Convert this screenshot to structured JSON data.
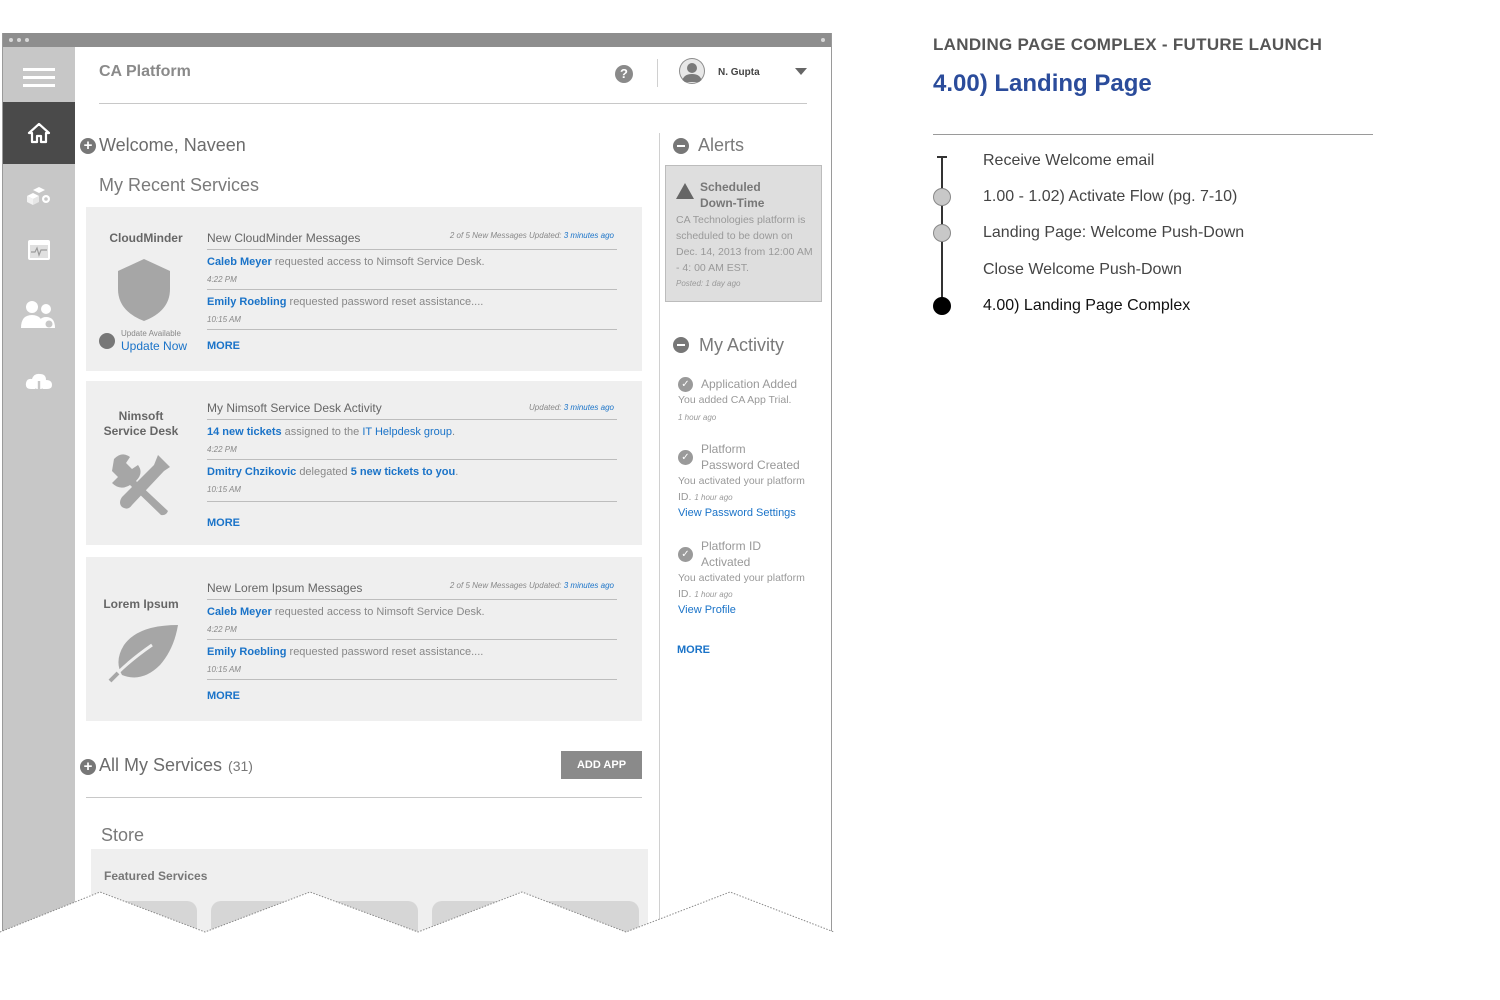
{
  "window": {
    "dots": 3
  },
  "header": {
    "app_title": "CA Platform",
    "help_glyph": "?",
    "user_name": "N. Gupta"
  },
  "sidebar": {
    "items": [
      {
        "icon": "home-icon"
      },
      {
        "icon": "apps-icon"
      },
      {
        "icon": "monitor-icon"
      },
      {
        "icon": "users-icon"
      },
      {
        "icon": "cloud-download-icon"
      }
    ]
  },
  "main": {
    "welcome": "Welcome, Naveen",
    "recent_heading": "My Recent Services",
    "cards": [
      {
        "name": "CloudMinder",
        "heading": "New CloudMinder Messages",
        "updated_prefix": "2 of 5 New Messages Updated:",
        "updated_link": "3 minutes ago",
        "msg1": {
          "who": "Caleb Meyer",
          "text": "requested access to Nimsoft Service Desk.",
          "time": "4:22 PM"
        },
        "msg2": {
          "who": "Emily Roebling",
          "text": "requested password reset assistance....",
          "time": "10:15 AM"
        },
        "more": "MORE",
        "update_available": "Update Available",
        "update_now": "Update Now"
      },
      {
        "name_line1": "Nimsoft",
        "name_line2": "Service Desk",
        "heading": "My Nimsoft Service Desk Activity",
        "updated_prefix": "Updated:",
        "updated_link": "3 minutes ago",
        "msg1": {
          "who": "14 new tickets",
          "text": "assigned to the",
          "link": "IT Helpdesk group",
          "end": ".",
          "time": "4:22 PM"
        },
        "msg2": {
          "who": "Dmitry Chzikovic",
          "text": "delegated",
          "link": "5 new tickets to you",
          "end": ".",
          "time": "10:15 AM"
        },
        "more": "MORE"
      },
      {
        "name": "Lorem Ipsum",
        "heading": "New Lorem Ipsum Messages",
        "updated_prefix": "2 of 5 New Messages Updated:",
        "updated_link": "3 minutes ago",
        "msg1": {
          "who": "Caleb Meyer",
          "text": "requested access to Nimsoft Service Desk.",
          "time": "4:22 PM"
        },
        "msg2": {
          "who": "Emily Roebling",
          "text": "requested password reset assistance....",
          "time": "10:15 AM"
        },
        "more": "MORE"
      }
    ],
    "all_services": "All My Services",
    "all_services_count": "(31)",
    "add_app": "ADD APP",
    "store": "Store",
    "featured": "Featured Services"
  },
  "right": {
    "alerts_heading": "Alerts",
    "alert": {
      "title_line1": "Scheduled",
      "title_line2": "Down-Time",
      "body": "CA Technologies platform is scheduled to be down on Dec. 14, 2013 from 12:00 AM - 4: 00 AM EST.",
      "posted": "Posted: 1 day ago"
    },
    "activity_heading": "My Activity",
    "activities": [
      {
        "title": "Application Added",
        "body": "You added CA App Trial.",
        "time": "1 hour ago"
      },
      {
        "title_line1": "Platform",
        "title_line2": "Password Created",
        "body": "You activated your platform ID.",
        "time": "1 hour ago",
        "link": "View Password Settings"
      },
      {
        "title_line1": "Platform ID",
        "title_line2": "Activated",
        "body": "You activated your platform ID.",
        "time": "1 hour ago",
        "link": "View Profile"
      }
    ],
    "more": "MORE"
  },
  "annotation": {
    "subtitle": "LANDING PAGE COMPLEX - FUTURE LAUNCH",
    "title": "4.00) Landing Page",
    "steps": [
      {
        "label": "Receive Welcome email",
        "node": "cap"
      },
      {
        "label": "1.00 - 1.02) Activate Flow (pg. 7-10)",
        "node": "circle"
      },
      {
        "label": "Landing Page: Welcome Push-Down",
        "node": "circle"
      },
      {
        "label": "Close Welcome Push-Down",
        "node": "none"
      },
      {
        "label": "4.00) Landing Page Complex",
        "node": "final"
      }
    ]
  },
  "colors": {
    "link": "#1a73c8",
    "annotation_title": "#2b4c9b",
    "sidebar": "#c7c7c7",
    "sidebar_active": "#4a4a4a"
  }
}
